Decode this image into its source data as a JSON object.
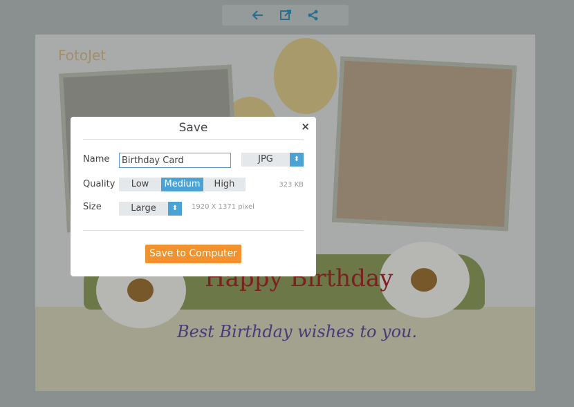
{
  "toolbar": {
    "icons": [
      "arrow-left-icon",
      "open-external-icon",
      "share-icon"
    ],
    "icon_color": "#2a6f8e"
  },
  "card": {
    "logo": "FotoJet",
    "headline": "Happy Birthday",
    "wish": "Best Birthday wishes to you."
  },
  "dialog": {
    "title": "Save",
    "close": "×",
    "name_label": "Name",
    "name_value": "Birthday Card",
    "format": "JPG",
    "quality_label": "Quality",
    "quality_options": [
      "Low",
      "Medium",
      "High"
    ],
    "quality_selected": "Medium",
    "file_size": "323 KB",
    "size_label": "Size",
    "size_value": "Large",
    "dimensions": "1920 X 1371 pixel",
    "save_button": "Save to Computer",
    "accent": "#4aa3d4",
    "button_color": "#f0922e"
  }
}
